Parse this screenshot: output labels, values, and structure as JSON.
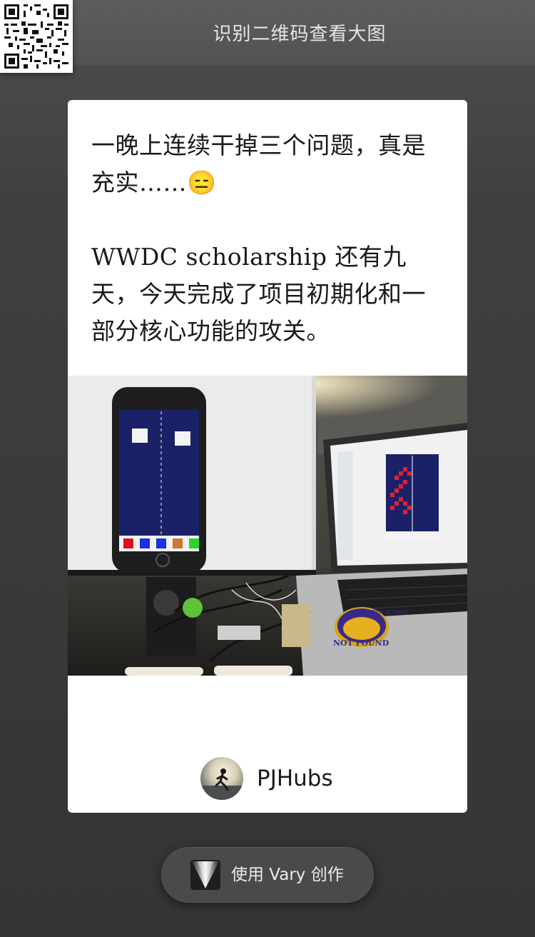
{
  "top_bar": {
    "title": "识别二维码查看大图",
    "qr_icon": "qr-code-icon"
  },
  "post": {
    "paragraphs": [
      "一晚上连续干掉三个问题，真是充实……😑",
      "WWDC scholarship 还有九天，今天完成了项目初期化和一部分核心功能的攻关。"
    ],
    "photo_sticker_text": "NOT FOUND",
    "photo_sticker_top": "OPEN SOURCE"
  },
  "author": {
    "name": "PJHubs",
    "avatar_icon": "avatar-runner"
  },
  "create_button": {
    "label": "使用 Vary 创作",
    "logo_icon": "vary-logo-icon"
  },
  "colors": {
    "background": "#3a3a3a",
    "card": "#ffffff",
    "top_bar": "#575757",
    "button": "#4a4a4a"
  }
}
